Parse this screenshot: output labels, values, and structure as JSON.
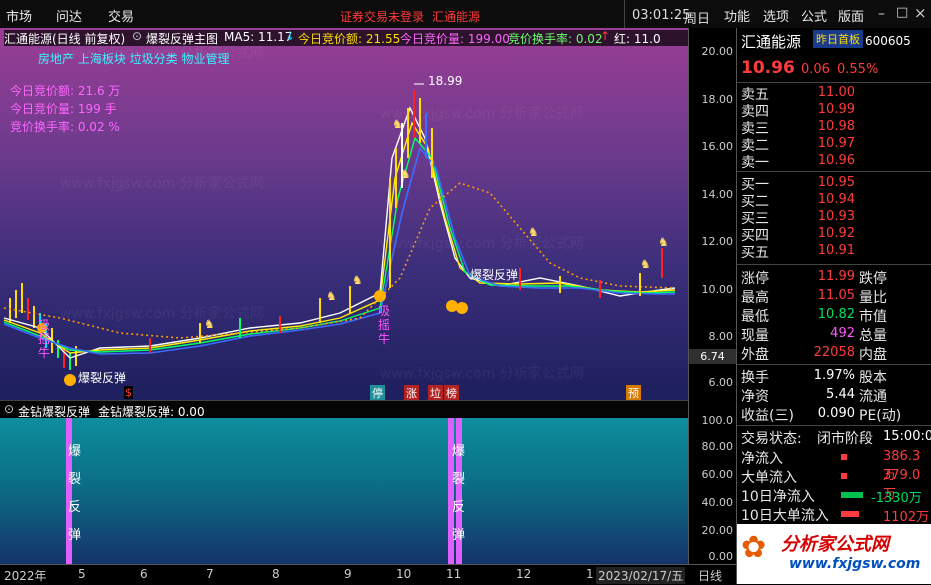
{
  "topbar": {
    "menu_left": [
      "市场",
      "问达",
      "交易"
    ],
    "warning": "证券交易未登录",
    "stock": "汇通能源",
    "time": "03:01:25",
    "weekday": "周日",
    "menu_right": [
      "功能",
      "选项",
      "公式",
      "版面"
    ]
  },
  "chart": {
    "title": "汇通能源(日线 前复权)",
    "formula": "爆裂反弹主图",
    "ma5_label": "MA5: 11.17",
    "jj_amount_label": "今日竞价额: 21.55",
    "jj_volume_label": "今日竞价量: 199.00",
    "jj_turnover_label": "竞价换手率: 0.02",
    "red_label": "红: 11.0",
    "sector_tag": "房地产 上海板块 垃圾分类 物业管理",
    "info_lines": [
      "今日竞价额: 21.6 万",
      "今日竞价量: 199 手",
      "竞价换手率: 0.02 %"
    ],
    "high_label": "18.99",
    "cross_value": "6.74",
    "signal_bursts": [
      "爆裂反弹",
      "爆裂反弹"
    ],
    "signal_buys": [
      "吸\n摇\n牛",
      "吸\n摇\n牛"
    ],
    "event_tags": [
      "$",
      "停",
      "涨",
      "垃",
      "榜",
      "预"
    ],
    "y_ticks": [
      "20.00",
      "18.00",
      "16.00",
      "14.00",
      "12.00",
      "10.00",
      "8.00",
      "6.00"
    ],
    "x_ticks": [
      "2022年",
      "5",
      "6",
      "7",
      "8",
      "9",
      "10",
      "11",
      "12",
      "1",
      "2023/02/17/五"
    ]
  },
  "sub": {
    "title": "金钻爆裂反弹",
    "value_label": "金钻爆裂反弹: 0.00",
    "y_ticks": [
      "100.0",
      "80.00",
      "60.00",
      "40.00",
      "20.00",
      "0.00"
    ],
    "bar_text": "爆裂反弹"
  },
  "quote": {
    "name": "汇通能源",
    "badge": "昨日首板",
    "code": "600605",
    "price": "10.96",
    "change": "0.06",
    "change_pct": "0.55%",
    "asks": [
      {
        "label": "卖五",
        "price": "11.00"
      },
      {
        "label": "卖四",
        "price": "10.99"
      },
      {
        "label": "卖三",
        "price": "10.98"
      },
      {
        "label": "卖二",
        "price": "10.97"
      },
      {
        "label": "卖一",
        "price": "10.96"
      }
    ],
    "bids": [
      {
        "label": "买一",
        "price": "10.95"
      },
      {
        "label": "买二",
        "price": "10.94"
      },
      {
        "label": "买三",
        "price": "10.93"
      },
      {
        "label": "买四",
        "price": "10.92"
      },
      {
        "label": "买五",
        "price": "10.91"
      }
    ],
    "stats": [
      {
        "label": "涨停",
        "value": "11.99",
        "label2": "跌停"
      },
      {
        "label": "最高",
        "value": "11.05",
        "label2": "量比"
      },
      {
        "label": "最低",
        "value": "10.82",
        "label2": "市值"
      },
      {
        "label": "现量",
        "value": "492",
        "label2": "总量"
      },
      {
        "label": "外盘",
        "value": "22058",
        "label2": "内盘"
      }
    ],
    "stats2": [
      {
        "label": "换手",
        "value": "1.97%",
        "label2": "股本"
      },
      {
        "label": "净资",
        "value": "5.44",
        "label2": "流通"
      },
      {
        "label": "收益(三)",
        "value": "0.090",
        "label2": "PE(动)"
      }
    ],
    "trade_state_label": "交易状态:",
    "trade_state": "闭市阶段",
    "trade_time": "15:00:0",
    "flows": [
      {
        "label": "净流入",
        "value": "386.3万"
      },
      {
        "label": "大单流入",
        "value": "379.0万"
      },
      {
        "label": "10日净流入",
        "value": "-1330万"
      },
      {
        "label": "10日大单流入",
        "value": "1102万"
      }
    ],
    "logo_text": "分析家公式网",
    "logo_url": "www.fxjgsw.com",
    "bottom_tab": "日线"
  }
}
